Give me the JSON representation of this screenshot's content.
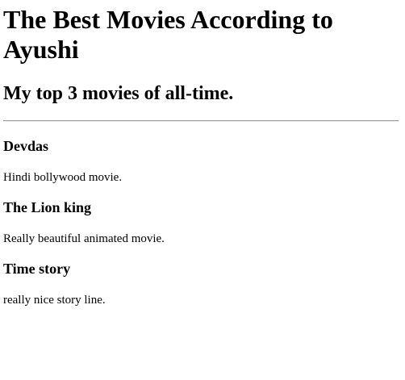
{
  "page": {
    "title": "The Best Movies According to Ayushi",
    "subtitle": "My top 3 movies of all-time."
  },
  "movies": [
    {
      "name": "Devdas",
      "description": "Hindi bollywood movie."
    },
    {
      "name": "The Lion king",
      "description": "Really beautiful animated movie."
    },
    {
      "name": "Time story",
      "description": "really nice story line."
    }
  ]
}
